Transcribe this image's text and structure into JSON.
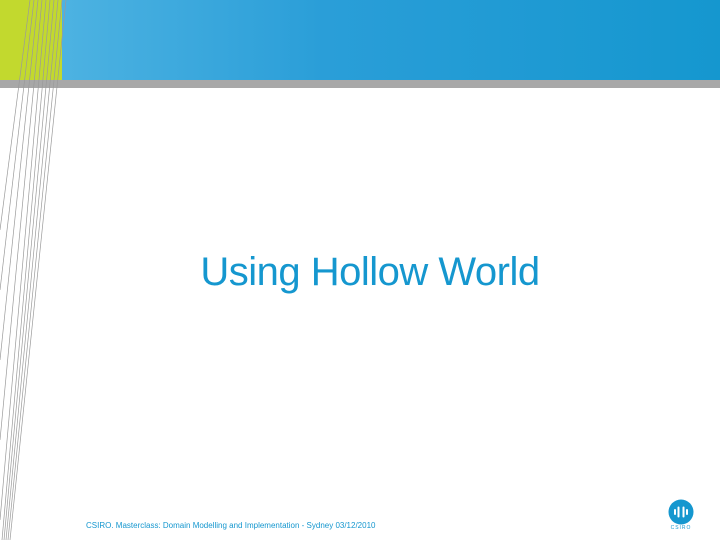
{
  "slide": {
    "title": "Using Hollow World",
    "footer": "CSIRO.  Masterclass: Domain Modelling and Implementation - Sydney 03/12/2010",
    "logo_text": "CSIRO",
    "logo_icon": "csiro-logo-icon"
  },
  "colors": {
    "accent_blue": "#1597cf",
    "light_blue": "#55b7e4",
    "green": "#c2d92e",
    "gray": "#a8a8a8"
  }
}
